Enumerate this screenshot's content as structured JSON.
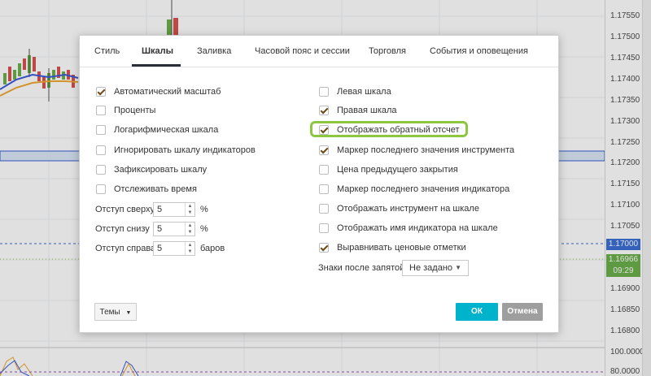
{
  "tabs": [
    "Стиль",
    "Шкалы",
    "Заливка",
    "Часовой пояс и сессии",
    "Торговля",
    "События и оповещения"
  ],
  "active_tab": "Шкалы",
  "left_options": [
    {
      "label": "Автоматический масштаб",
      "checked": true
    },
    {
      "label": "Проценты",
      "checked": false
    },
    {
      "label": "Логарифмическая шкала",
      "checked": false
    },
    {
      "label": "Игнорировать шкалу индикаторов",
      "checked": false
    },
    {
      "label": "Зафиксировать шкалу",
      "checked": false
    },
    {
      "label": "Отслеживать время",
      "checked": false
    }
  ],
  "right_options": [
    {
      "label": "Левая шкала",
      "checked": false
    },
    {
      "label": "Правая шкала",
      "checked": true
    },
    {
      "label": "Отображать обратный отсчет",
      "checked": true
    },
    {
      "label": "Маркер последнего значения инструмента",
      "checked": true
    },
    {
      "label": "Цена предыдущего закрытия",
      "checked": false
    },
    {
      "label": "Маркер последнего значения индикатора",
      "checked": false
    },
    {
      "label": "Отображать инструмент на шкале",
      "checked": false
    },
    {
      "label": "Отображать имя индикатора на шкале",
      "checked": false
    },
    {
      "label": "Выравнивать ценовые отметки",
      "checked": true
    }
  ],
  "margins": {
    "top": {
      "label": "Отступ сверху",
      "value": "5",
      "unit": "%"
    },
    "bottom": {
      "label": "Отступ снизу",
      "value": "5",
      "unit": "%"
    },
    "right": {
      "label": "Отступ справа",
      "value": "5",
      "unit": "баров"
    }
  },
  "decimals": {
    "label": "Знаки после запятой",
    "value": "Не задано"
  },
  "buttons": {
    "themes": "Темы",
    "ok": "ОК",
    "cancel": "Отмена"
  },
  "price_scale": [
    "1.17550",
    "1.17500",
    "1.17450",
    "1.17400",
    "1.17350",
    "1.17300",
    "1.17250",
    "1.17200",
    "1.17150",
    "1.17100",
    "1.17050",
    "1.17000",
    "1.16900",
    "1.16850",
    "1.16800"
  ],
  "price_tags": {
    "current": "1.17000",
    "last": "1.16966",
    "countdown": "09:29"
  },
  "oscillator_scale": [
    "100.0000",
    "80.0000"
  ],
  "colors": {
    "accent_ok": "#00b3cc",
    "highlight": "#8dc63f",
    "up_candle": "#6ab04c",
    "down_candle": "#d9534f"
  }
}
